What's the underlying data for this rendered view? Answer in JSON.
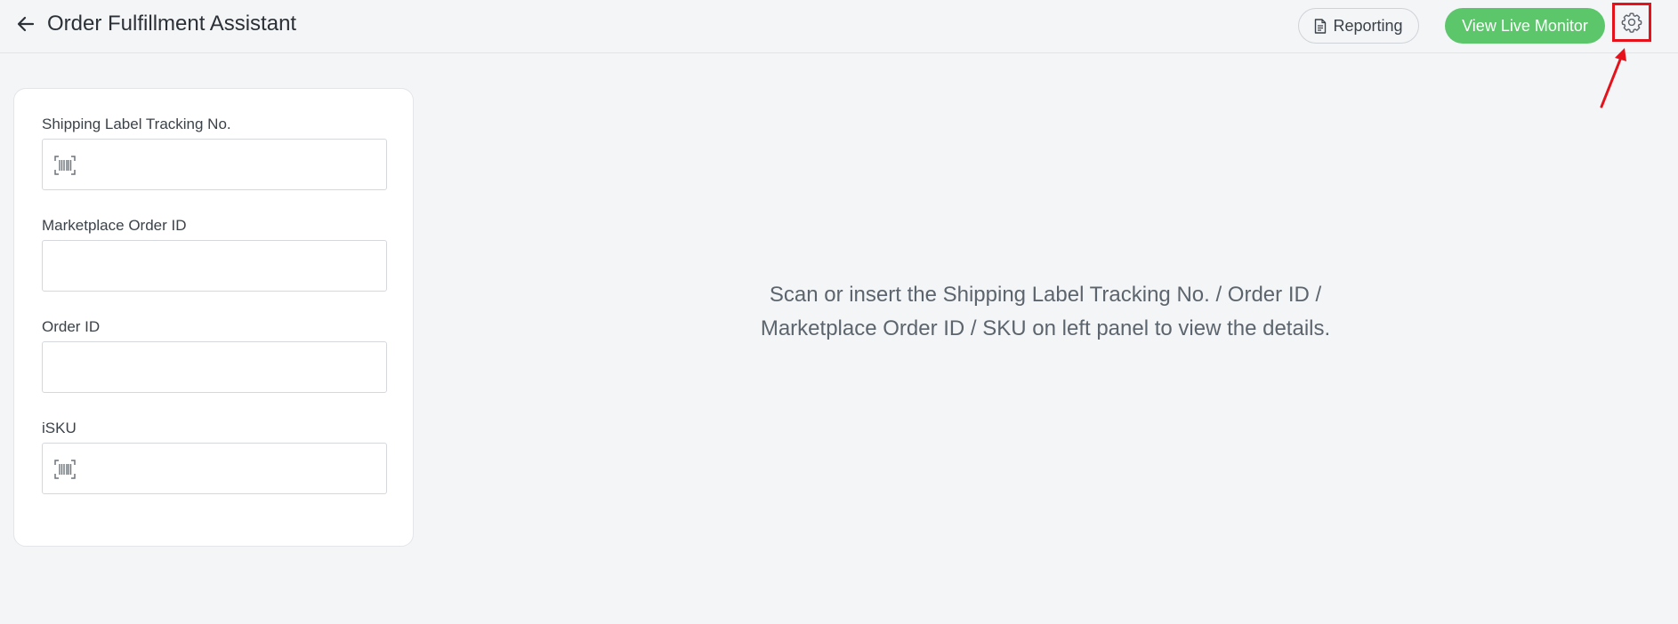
{
  "header": {
    "title": "Order Fulfillment Assistant",
    "reporting_label": "Reporting",
    "live_monitor_label": "View Live Monitor"
  },
  "form": {
    "fields": [
      {
        "label": "Shipping Label Tracking No.",
        "value": "",
        "icon": "barcode-scan-icon"
      },
      {
        "label": "Marketplace Order ID",
        "value": ""
      },
      {
        "label": "Order ID",
        "value": ""
      },
      {
        "label": "iSKU",
        "value": "",
        "icon": "barcode-scan-icon"
      }
    ]
  },
  "main": {
    "empty_line1": "Scan or insert the Shipping Label Tracking No. / Order ID /",
    "empty_line2": "Marketplace Order ID / SKU on left panel to view the details."
  },
  "colors": {
    "accent_green": "#5cc66b",
    "annotation_red": "#e6121b",
    "background": "#f4f5f7"
  }
}
